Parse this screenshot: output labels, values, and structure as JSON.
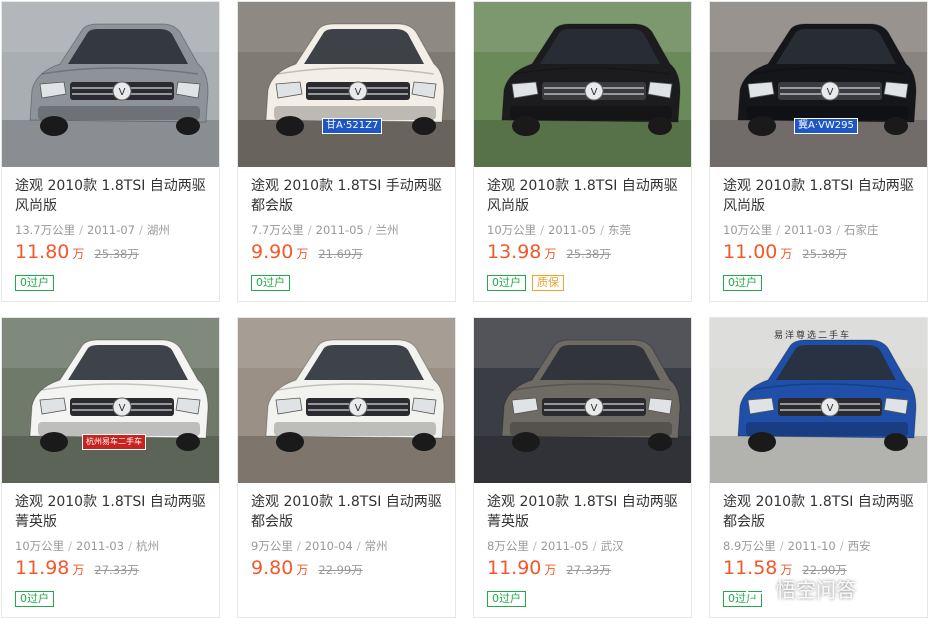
{
  "listings": [
    {
      "title_line1": "途观 2010款 1.8TSI 自动两驱",
      "title_line2": "风尚版",
      "mileage": "13.7万公里",
      "date": "2011-07",
      "city": "湖州",
      "price": "11.80",
      "price_unit": "万",
      "original_price": "25.38万",
      "tags": [
        "0过户"
      ],
      "car_color": "#8e9399",
      "photo_bg": "#a9aeb3",
      "plate_text": ""
    },
    {
      "title_line1": "途观 2010款 1.8TSI 手动两驱",
      "title_line2": "都会版",
      "mileage": "7.7万公里",
      "date": "2011-05",
      "city": "兰州",
      "price": "9.90",
      "price_unit": "万",
      "original_price": "21.69万",
      "tags": [
        "0过户"
      ],
      "car_color": "#f3efe6",
      "photo_bg": "#7f7a72",
      "plate_text": "甘A·521Z7"
    },
    {
      "title_line1": "途观 2010款 1.8TSI 自动两驱",
      "title_line2": "风尚版",
      "mileage": "10万公里",
      "date": "2011-05",
      "city": "东莞",
      "price": "13.98",
      "price_unit": "万",
      "original_price": "25.38万",
      "tags": [
        "0过户",
        "质保"
      ],
      "car_color": "#1c1c1f",
      "photo_bg": "#6b8a5a",
      "plate_text": ""
    },
    {
      "title_line1": "途观 2010款 1.8TSI 自动两驱",
      "title_line2": "风尚版",
      "mileage": "10万公里",
      "date": "2011-03",
      "city": "石家庄",
      "price": "11.00",
      "price_unit": "万",
      "original_price": "25.38万",
      "tags": [
        "0过户"
      ],
      "car_color": "#15161a",
      "photo_bg": "#8a8480",
      "plate_text": "冀A·VW295"
    },
    {
      "title_line1": "途观 2010款 1.8TSI 自动两驱",
      "title_line2": "菁英版",
      "mileage": "10万公里",
      "date": "2011-03",
      "city": "杭州",
      "price": "11.98",
      "price_unit": "万",
      "original_price": "27.33万",
      "tags": [
        "0过户"
      ],
      "car_color": "#f4f4f2",
      "photo_bg": "#6f7a6a",
      "plate_text": "杭州易车二手车"
    },
    {
      "title_line1": "途观 2010款 1.8TSI 自动两驱",
      "title_line2": "都会版",
      "mileage": "9万公里",
      "date": "2010-04",
      "city": "常州",
      "price": "9.80",
      "price_unit": "万",
      "original_price": "22.99万",
      "tags": [],
      "car_color": "#f2f2ef",
      "photo_bg": "#9a9086",
      "plate_text": ""
    },
    {
      "title_line1": "途观 2010款 1.8TSI 自动两驱",
      "title_line2": "菁英版",
      "mileage": "8万公里",
      "date": "2011-05",
      "city": "武汉",
      "price": "11.90",
      "price_unit": "万",
      "original_price": "27.33万",
      "tags": [
        "0过户"
      ],
      "car_color": "#6e6a64",
      "photo_bg": "#3b3d44",
      "plate_text": ""
    },
    {
      "title_line1": "途观 2010款 1.8TSI 自动两驱",
      "title_line2": "都会版",
      "mileage": "8.9万公里",
      "date": "2011-10",
      "city": "西安",
      "price": "11.58",
      "price_unit": "万",
      "original_price": "22.90万",
      "tags": [
        "0过户"
      ],
      "car_color": "#1f4fa8",
      "photo_bg": "#d9d9d6",
      "plate_text": "",
      "dealer_sign": "易洋尊选二手车"
    }
  ],
  "watermark": {
    "text": "悟空问答",
    "icon": "chat-bubble-icon"
  }
}
